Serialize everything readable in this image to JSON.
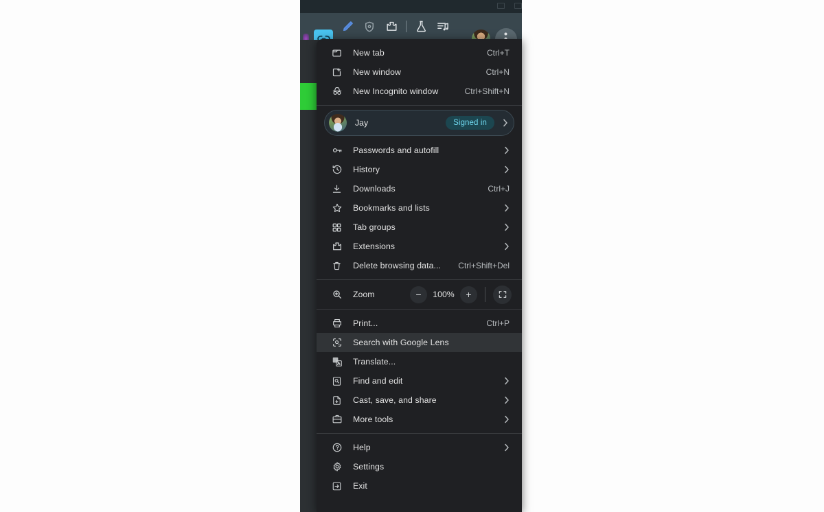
{
  "window": {
    "toolbar_icons": [
      {
        "name": "link-chip-icon",
        "label": "Link"
      },
      {
        "name": "pen-icon",
        "label": "Pen"
      },
      {
        "name": "shield-icon",
        "label": "Shield"
      },
      {
        "name": "extensions-puzzle-icon",
        "label": "Extensions"
      },
      {
        "name": "toolbar-divider",
        "label": ""
      },
      {
        "name": "flask-labs-icon",
        "label": "Labs"
      },
      {
        "name": "media-playlist-icon",
        "label": "Media"
      },
      {
        "name": "toolbar-avatar",
        "label": "Profile"
      },
      {
        "name": "three-dot-menu-icon",
        "label": "Customize and control"
      }
    ]
  },
  "menu": {
    "section_new": [
      {
        "icon": "new-tab-icon",
        "label": "New tab",
        "accel": "Ctrl+T",
        "chevron": false
      },
      {
        "icon": "new-window-icon",
        "label": "New window",
        "accel": "Ctrl+N",
        "chevron": false
      },
      {
        "icon": "incognito-icon",
        "label": "New Incognito window",
        "accel": "Ctrl+Shift+N",
        "chevron": false
      }
    ],
    "profile": {
      "name": "Jay",
      "badge": "Signed in",
      "chevron": "›"
    },
    "section_main": [
      {
        "icon": "key-icon",
        "label": "Passwords and autofill",
        "accel": "",
        "chevron": true
      },
      {
        "icon": "history-clock-icon",
        "label": "History",
        "accel": "",
        "chevron": true
      },
      {
        "icon": "download-icon",
        "label": "Downloads",
        "accel": "Ctrl+J",
        "chevron": false
      },
      {
        "icon": "star-icon",
        "label": "Bookmarks and lists",
        "accel": "",
        "chevron": true
      },
      {
        "icon": "tab-groups-grid-icon",
        "label": "Tab groups",
        "accel": "",
        "chevron": true
      },
      {
        "icon": "extensions-puzzle-icon",
        "label": "Extensions",
        "accel": "",
        "chevron": true
      },
      {
        "icon": "trash-icon",
        "label": "Delete browsing data...",
        "accel": "Ctrl+Shift+Del",
        "chevron": false
      }
    ],
    "zoom": {
      "icon": "magnifier-icon",
      "label": "Zoom",
      "minus": "−",
      "level": "100%",
      "plus": "+",
      "fullscreen_icon": "fullscreen-icon"
    },
    "section_tools": [
      {
        "icon": "printer-icon",
        "label": "Print...",
        "accel": "Ctrl+P",
        "chevron": false,
        "highlight": false
      },
      {
        "icon": "google-lens-icon",
        "label": "Search with Google Lens",
        "accel": "",
        "chevron": false,
        "highlight": true
      },
      {
        "icon": "translate-icon",
        "label": "Translate...",
        "accel": "",
        "chevron": false,
        "highlight": false
      },
      {
        "icon": "find-and-edit-icon",
        "label": "Find and edit",
        "accel": "",
        "chevron": true,
        "highlight": false
      },
      {
        "icon": "cast-save-share-icon",
        "label": "Cast, save, and share",
        "accel": "",
        "chevron": true,
        "highlight": false
      },
      {
        "icon": "more-tools-icon",
        "label": "More tools",
        "accel": "",
        "chevron": true,
        "highlight": false
      }
    ],
    "section_footer": [
      {
        "icon": "help-icon",
        "label": "Help",
        "accel": "",
        "chevron": true
      },
      {
        "icon": "settings-gear-icon",
        "label": "Settings",
        "accel": "",
        "chevron": false
      },
      {
        "icon": "exit-icon",
        "label": "Exit",
        "accel": "",
        "chevron": false
      }
    ]
  },
  "colors": {
    "menu_bg": "#1f2023",
    "toolbar_bg": "#39474e",
    "tabstrip_bg": "#20292e",
    "highlight_row": "#313437",
    "badge_bg": "#1c4650",
    "badge_text": "#6fd8ef",
    "green_block": "#2ecc37",
    "link_chip": "#49c3ef"
  }
}
